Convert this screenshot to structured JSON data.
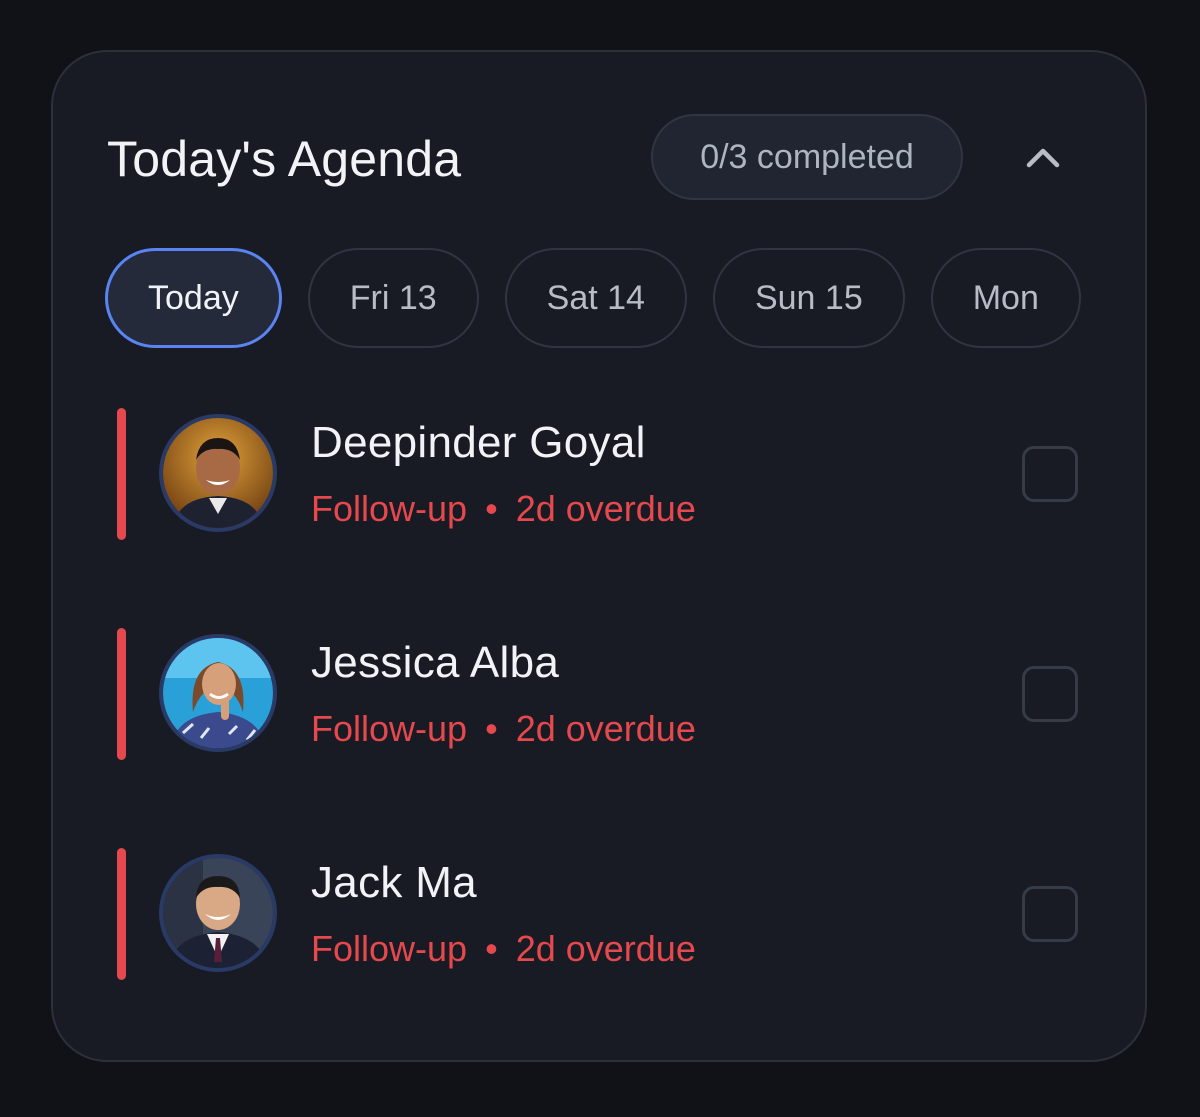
{
  "header": {
    "title": "Today's Agenda",
    "progress_badge": "0/3 completed",
    "completed": 0,
    "total": 3,
    "collapse_icon": "chevron-up-icon"
  },
  "day_tabs": [
    {
      "label": "Today",
      "active": true
    },
    {
      "label": "Fri 13",
      "active": false
    },
    {
      "label": "Sat 14",
      "active": false
    },
    {
      "label": "Sun 15",
      "active": false
    },
    {
      "label": "Mon",
      "active": false
    }
  ],
  "agenda": [
    {
      "name": "Deepinder Goyal",
      "type": "Follow-up",
      "separator": "•",
      "status": "2d overdue",
      "checked": false,
      "avatar_icon": "person-avatar-icon"
    },
    {
      "name": "Jessica Alba",
      "type": "Follow-up",
      "separator": "•",
      "status": "2d overdue",
      "checked": false,
      "avatar_icon": "person-avatar-icon"
    },
    {
      "name": "Jack Ma",
      "type": "Follow-up",
      "separator": "•",
      "status": "2d overdue",
      "checked": false,
      "avatar_icon": "person-avatar-icon"
    }
  ],
  "colors": {
    "background": "#101217",
    "card": "#181b24",
    "accent": "#5a84f2",
    "overdue": "#e5484d",
    "text_primary": "#f1f3f6",
    "text_secondary": "#aeb4c0"
  }
}
